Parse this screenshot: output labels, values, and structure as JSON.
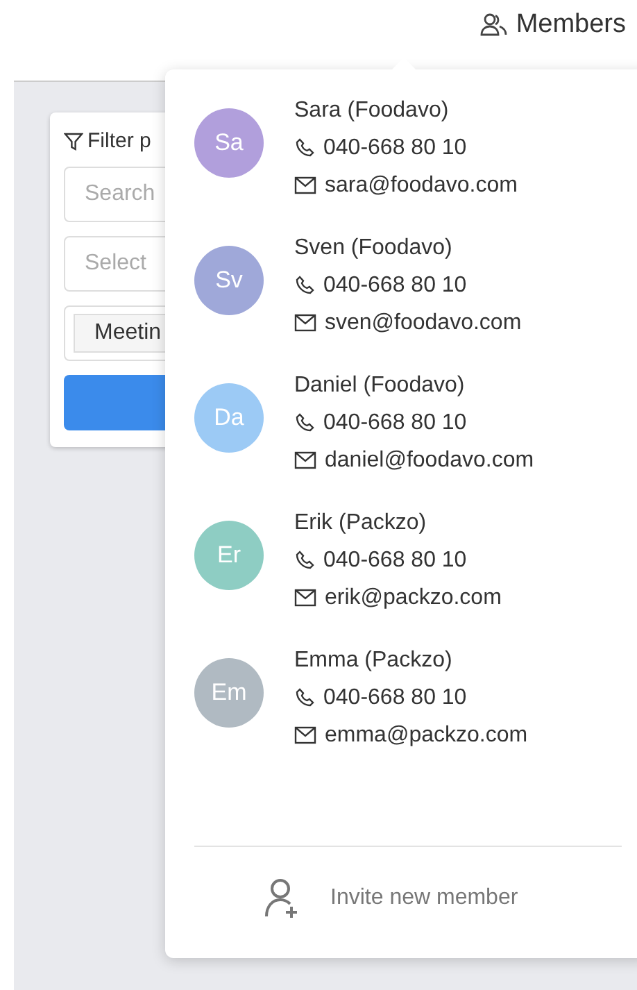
{
  "header": {
    "members_button": "Members"
  },
  "filter_panel": {
    "title": "Filter p",
    "search": {
      "placeholder": "Search"
    },
    "select": {
      "placeholder": "Select"
    },
    "tag": "Meetin"
  },
  "members": [
    {
      "initials": "Sa",
      "name": "Sara (Foodavo)",
      "phone": "040-668 80 10",
      "email": "sara@foodavo.com",
      "color": "#b19fdc"
    },
    {
      "initials": "Sv",
      "name": "Sven (Foodavo)",
      "phone": "040-668 80 10",
      "email": "sven@foodavo.com",
      "color": "#9fa8d9"
    },
    {
      "initials": "Da",
      "name": "Daniel (Foodavo)",
      "phone": "040-668 80 10",
      "email": "daniel@foodavo.com",
      "color": "#9ccaf5"
    },
    {
      "initials": "Er",
      "name": "Erik (Packzo)",
      "phone": "040-668 80 10",
      "email": "erik@packzo.com",
      "color": "#8ecdc3"
    },
    {
      "initials": "Em",
      "name": "Emma (Packzo)",
      "phone": "040-668 80 10",
      "email": "emma@packzo.com",
      "color": "#b0bac2"
    }
  ],
  "invite": "Invite new member"
}
